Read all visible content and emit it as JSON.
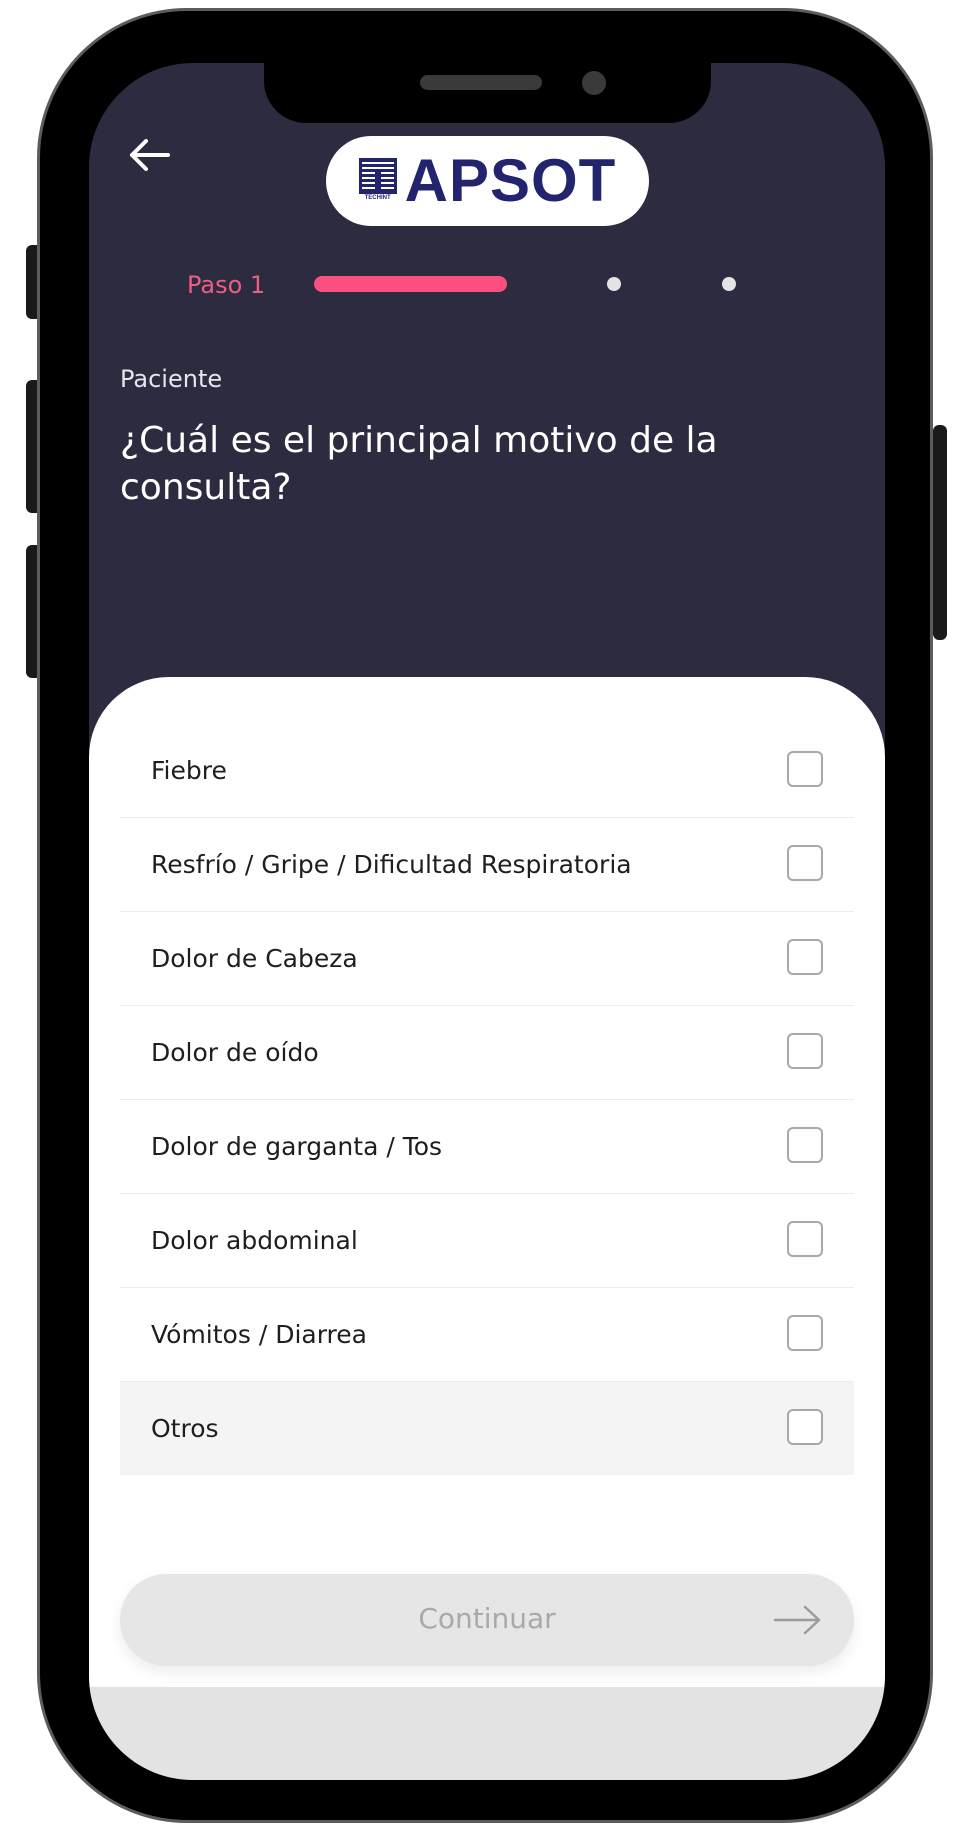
{
  "header": {
    "back_icon": "arrow-left-icon",
    "logo_text": "APSOT",
    "logo_mark_text": "TECHINT",
    "step_label": "Paso 1",
    "steps_total": 3,
    "current_step": 1
  },
  "question": {
    "label": "Paciente",
    "text": "¿Cuál es el principal motivo de la consulta?"
  },
  "options": [
    {
      "label": "Fiebre",
      "checked": false
    },
    {
      "label": "Resfrío / Gripe / Dificultad Respiratoria",
      "checked": false
    },
    {
      "label": "Dolor de Cabeza",
      "checked": false
    },
    {
      "label": "Dolor de oído",
      "checked": false
    },
    {
      "label": "Dolor de garganta / Tos",
      "checked": false
    },
    {
      "label": "Dolor abdominal",
      "checked": false
    },
    {
      "label": "Vómitos / Diarrea",
      "checked": false
    },
    {
      "label": "Otros",
      "checked": false
    }
  ],
  "continue": {
    "label": "Continuar",
    "icon": "arrow-right-icon",
    "enabled": false
  },
  "colors": {
    "header_bg": "#2c2b3f",
    "accent": "#fb4f7e",
    "logo_blue": "#23246e"
  }
}
